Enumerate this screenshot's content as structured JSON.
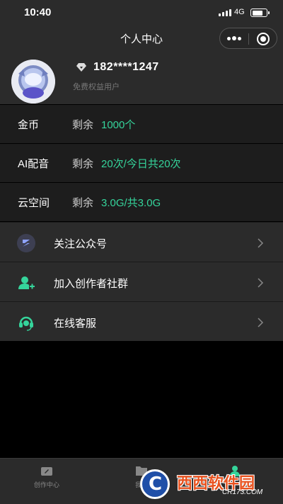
{
  "status_bar": {
    "time": "10:40",
    "network": "4G"
  },
  "nav": {
    "title": "个人中心"
  },
  "profile": {
    "phone": "182****1247",
    "tier": "免费权益用户"
  },
  "quotas": [
    {
      "name": "金币",
      "prefix": "剩余",
      "value": "1000个"
    },
    {
      "name": "AI配音",
      "prefix": "剩余",
      "value": "20次/今日共20次"
    },
    {
      "name": "云空间",
      "prefix": "剩余",
      "value": "3.0G/共3.0G"
    }
  ],
  "menu": [
    {
      "label": "关注公众号",
      "icon": "official-account-icon"
    },
    {
      "label": "加入创作者社群",
      "icon": "add-user-icon"
    },
    {
      "label": "在线客服",
      "icon": "headset-icon"
    }
  ],
  "tabs": [
    {
      "label": "创作中心",
      "icon": "camera-icon"
    },
    {
      "label": "我的",
      "icon": "folder-icon"
    },
    {
      "label": "",
      "icon": "person-icon"
    }
  ],
  "watermark": {
    "title": "西西软件园",
    "domain": "CR173.COM"
  },
  "colors": {
    "accent": "#35d49b",
    "background": "#000000",
    "panel": "#2b2b2b"
  }
}
